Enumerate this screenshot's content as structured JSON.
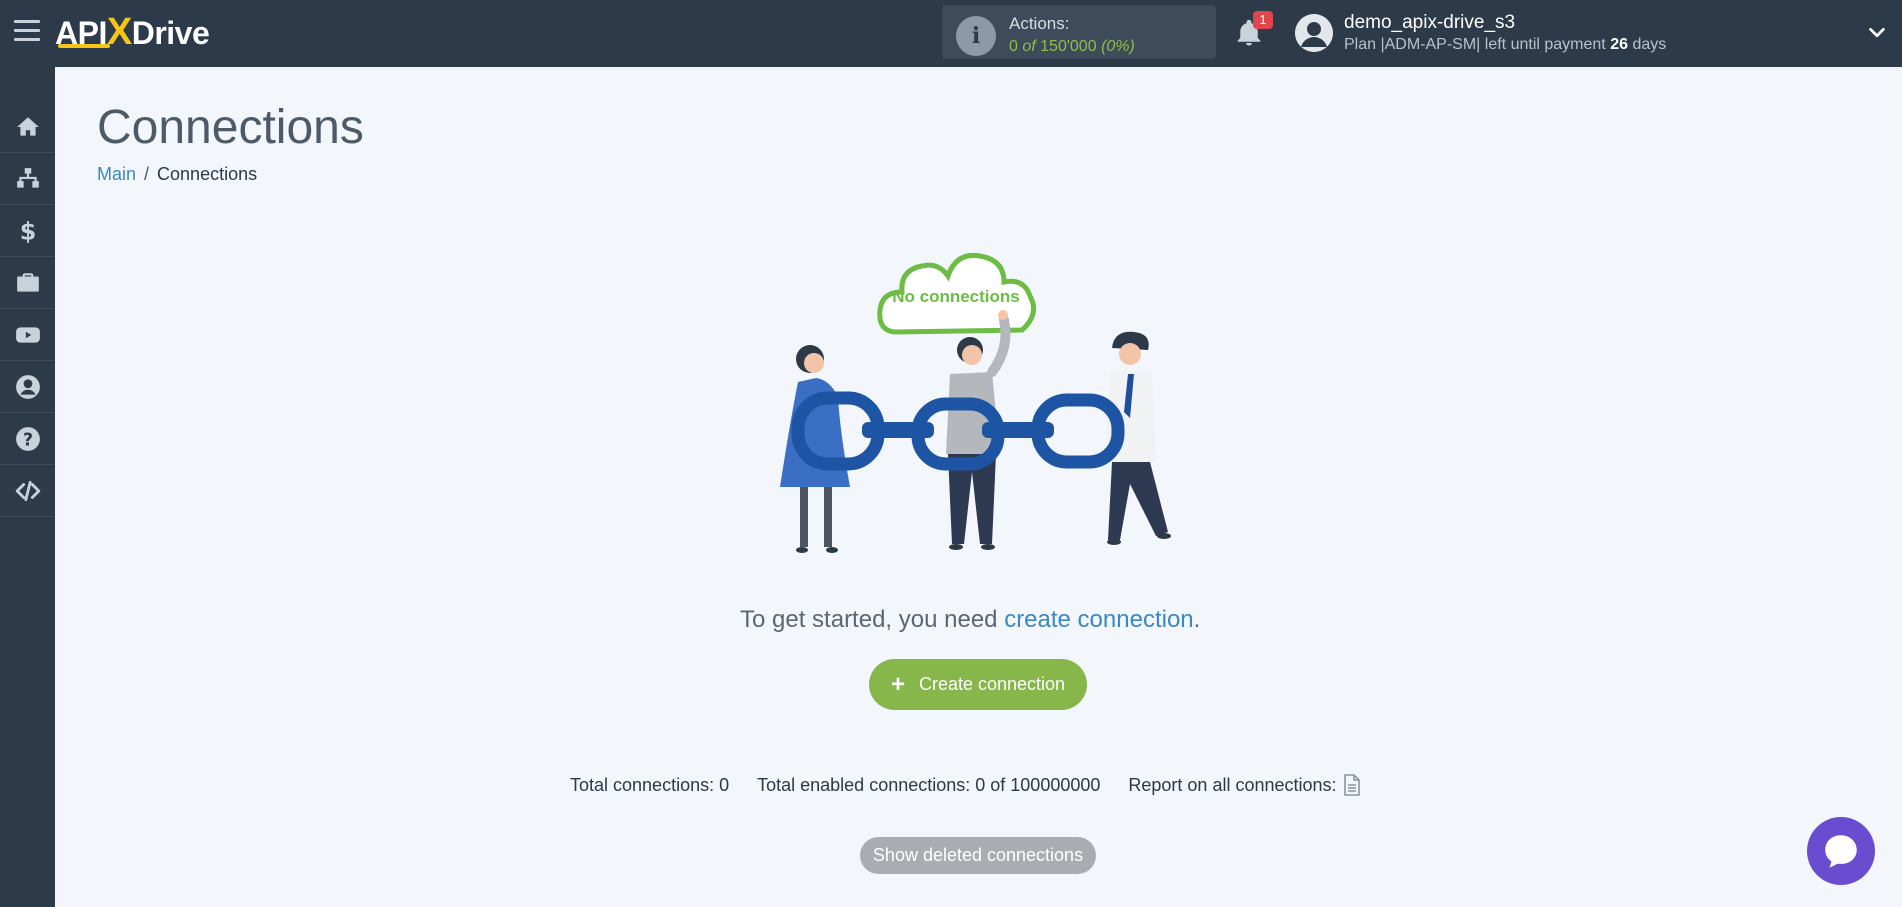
{
  "header": {
    "logo_api": "API",
    "logo_x": "X",
    "logo_drive": "Drive",
    "actions_label": "Actions:",
    "actions_used": "0",
    "actions_of": "of",
    "actions_total": "150'000",
    "actions_percent": "(0%)",
    "notifications_count": "1",
    "user_name": "demo_apix-drive_s3",
    "plan_prefix": "Plan |ADM-AP-SM| left until payment",
    "plan_days": "26",
    "plan_suffix": "days"
  },
  "sidebar": {
    "items": [
      {
        "name": "home-icon"
      },
      {
        "name": "sitemap-icon"
      },
      {
        "name": "dollar-icon"
      },
      {
        "name": "briefcase-icon"
      },
      {
        "name": "youtube-icon"
      },
      {
        "name": "user-circle-icon"
      },
      {
        "name": "help-icon"
      },
      {
        "name": "code-icon"
      }
    ]
  },
  "main": {
    "title": "Connections",
    "breadcrumb": {
      "main": "Main",
      "separator": "/",
      "current": "Connections"
    },
    "illustration_cloud_text": "No connections",
    "intro_prefix": "To get started, you need",
    "intro_link": "create connection",
    "intro_suffix": ".",
    "create_button": "Create connection",
    "stats": {
      "total": "Total connections: 0",
      "enabled": "Total enabled connections: 0 of 100000000",
      "report": "Report on all connections:"
    },
    "show_deleted_button": "Show deleted connections"
  },
  "colors": {
    "topbar": "#2c3a4a",
    "accent_green": "#87b74b",
    "link_blue": "#3c87c4",
    "chat_purple": "#6a4cd0"
  }
}
